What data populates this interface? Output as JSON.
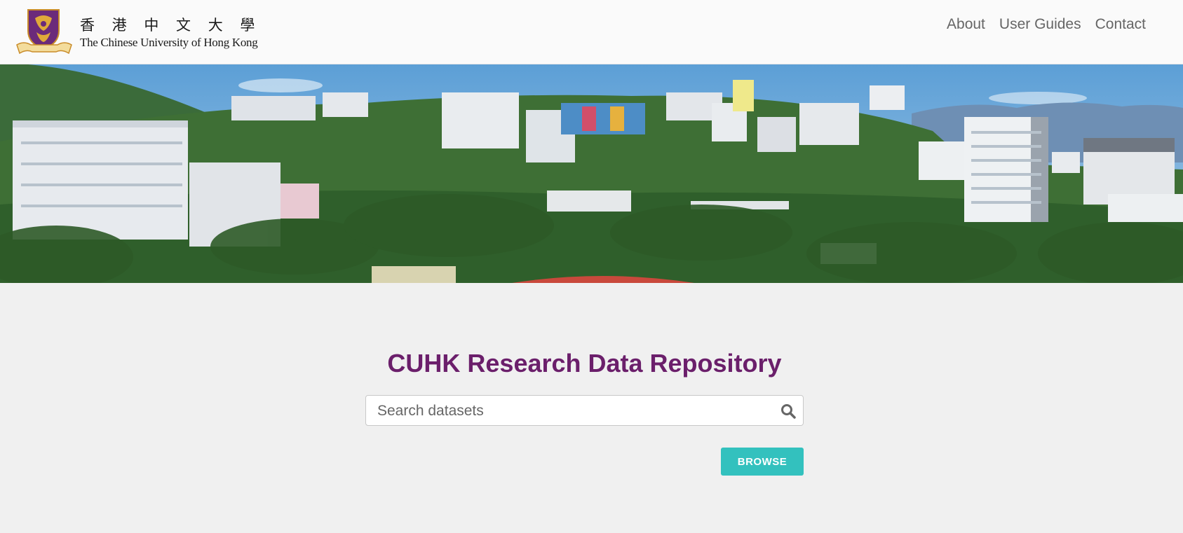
{
  "header": {
    "logo_zh": "香 港 中 文 大 學",
    "logo_en": "The Chinese University of Hong Kong",
    "nav": [
      {
        "label": "About"
      },
      {
        "label": "User Guides"
      },
      {
        "label": "Contact"
      }
    ]
  },
  "main": {
    "title": "CUHK Research Data Repository",
    "search": {
      "placeholder": "Search datasets",
      "value": ""
    },
    "browse_label": "BROWSE"
  },
  "colors": {
    "title": "#6b1f6b",
    "browse_button": "#33c1be",
    "page_background": "#f0f0f0",
    "header_background": "#fafafa",
    "crest_purple": "#6b2a7a",
    "crest_gold": "#e0a93a"
  },
  "icons": {
    "logo": "cuhk-crest-icon",
    "search": "search-icon"
  }
}
